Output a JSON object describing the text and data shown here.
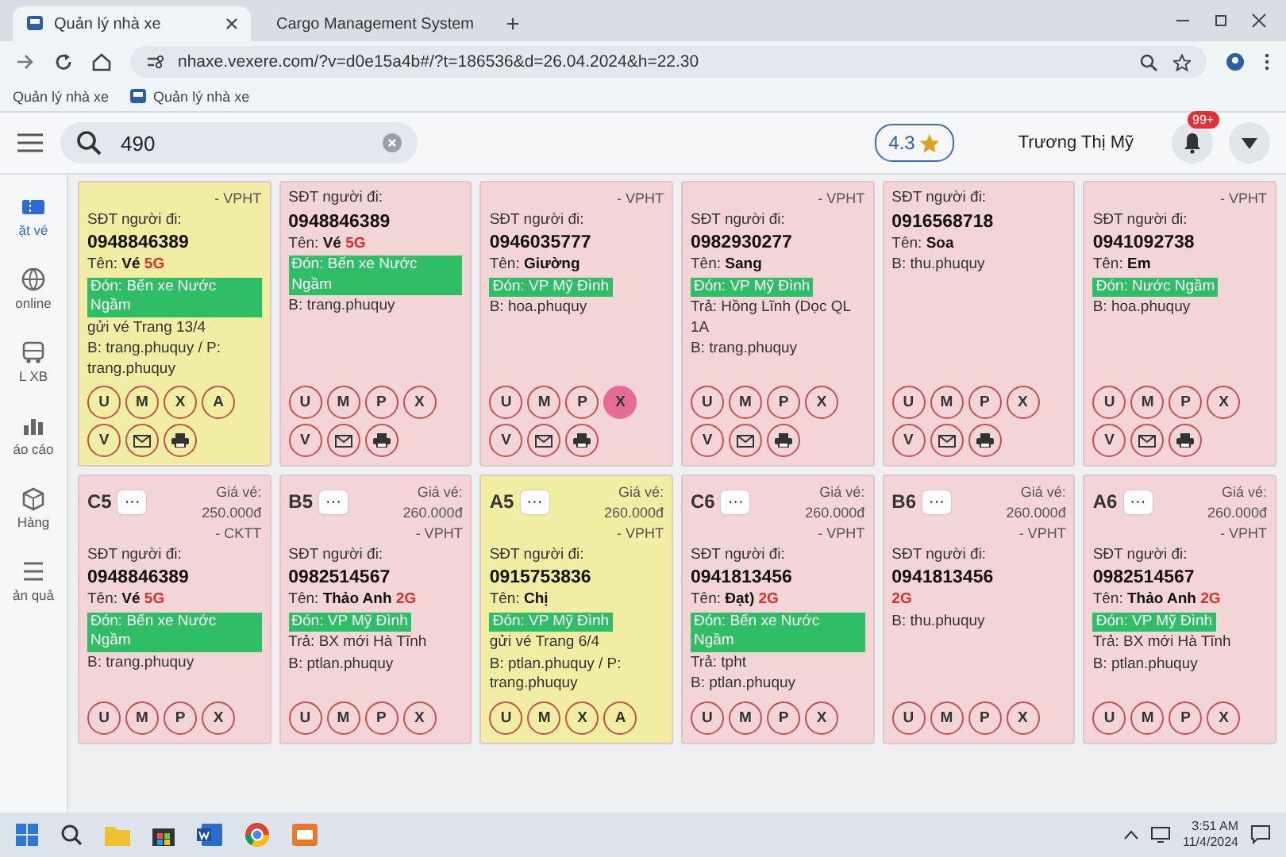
{
  "browser": {
    "tabs": [
      {
        "label": "Quản lý nhà xe",
        "selected": true
      },
      {
        "label": "Cargo Management System",
        "selected": false
      }
    ],
    "new_tab": "+",
    "url": "nhaxe.vexere.com/?v=d0e15a4b#/?t=186536&d=26.04.2024&h=22.30",
    "bookmarks": [
      "Quản lý nhà xe",
      "Quản lý nhà xe"
    ]
  },
  "header": {
    "search": {
      "value": "490"
    },
    "rating": "4.3",
    "user": "Trương Thị Mỹ",
    "notification_badge": "99+"
  },
  "sidebar": {
    "items": [
      {
        "label": "ặt vé",
        "selected": true
      },
      {
        "label": "online",
        "selected": false
      },
      {
        "label": "L XB",
        "selected": false
      },
      {
        "label": "áo cáo",
        "selected": false
      },
      {
        "label": "Hàng",
        "selected": false
      },
      {
        "label": "ản quả",
        "selected": false
      }
    ]
  },
  "cards": [
    {
      "color": "#f1eda3",
      "price_note": "- VPHT",
      "phone_label": "SĐT người đi:",
      "phone": "0948846389",
      "name_label": "Tên:",
      "name": "Vé",
      "tag": "5G",
      "pickup": "Đón: Bến xe Nước Ngầm",
      "note": "gửi vé Trang 13/4",
      "booked_by": "B: trang.phuquy / P: trang.phuquy",
      "actions": [
        {
          "kind": "letter",
          "label": "U",
          "selected": false
        },
        {
          "kind": "letter",
          "label": "M",
          "selected": false
        },
        {
          "kind": "letter",
          "label": "X",
          "selected": false
        },
        {
          "kind": "letter",
          "label": "A",
          "selected": false
        },
        {
          "kind": "letter",
          "label": "V",
          "selected": false
        },
        {
          "kind": "mail",
          "selected": false
        },
        {
          "kind": "print",
          "selected": false
        }
      ]
    },
    {
      "color": "#f3d5d8",
      "phone_label": "SĐT người đi:",
      "phone": "0948846389",
      "name_label": "Tên:",
      "name": "Vé",
      "tag": "5G",
      "pickup": "Đón: Bến xe Nước Ngầm",
      "booked_by": "B: trang.phuquy",
      "actions": [
        {
          "kind": "letter",
          "label": "U",
          "selected": false
        },
        {
          "kind": "letter",
          "label": "M",
          "selected": false
        },
        {
          "kind": "letter",
          "label": "P",
          "selected": false
        },
        {
          "kind": "letter",
          "label": "X",
          "selected": false
        },
        {
          "kind": "letter",
          "label": "V",
          "selected": false
        },
        {
          "kind": "mail",
          "selected": false
        },
        {
          "kind": "print",
          "selected": false
        }
      ]
    },
    {
      "color": "#f3d5d8",
      "price_note": "- VPHT",
      "phone_label": "SĐT người đi:",
      "phone": "0946035777",
      "name_label": "Tên:",
      "name": "Giường",
      "pickup": "Đón: VP Mỹ Đình",
      "booked_by": "B: hoa.phuquy",
      "actions": [
        {
          "kind": "letter",
          "label": "U",
          "selected": false
        },
        {
          "kind": "letter",
          "label": "M",
          "selected": false
        },
        {
          "kind": "letter",
          "label": "P",
          "selected": false
        },
        {
          "kind": "letter",
          "label": "X",
          "selected": true
        },
        {
          "kind": "letter",
          "label": "V",
          "selected": false
        },
        {
          "kind": "mail",
          "selected": false
        },
        {
          "kind": "print",
          "selected": false
        }
      ]
    },
    {
      "color": "#f3d5d8",
      "price_note": "- VPHT",
      "phone_label": "SĐT người đi:",
      "phone": "0982930277",
      "name_label": "Tên:",
      "name": "Sang",
      "pickup": "Đón: VP Mỹ Đình",
      "dropoff": "Trả: Hồng Lĩnh (Dọc QL 1A",
      "booked_by": "B: trang.phuquy",
      "actions": [
        {
          "kind": "letter",
          "label": "U",
          "selected": false
        },
        {
          "kind": "letter",
          "label": "M",
          "selected": false
        },
        {
          "kind": "letter",
          "label": "P",
          "selected": false
        },
        {
          "kind": "letter",
          "label": "X",
          "selected": false
        },
        {
          "kind": "letter",
          "label": "V",
          "selected": false
        },
        {
          "kind": "mail",
          "selected": false
        },
        {
          "kind": "print",
          "selected": false
        }
      ]
    },
    {
      "color": "#f3d5d8",
      "phone_label": "SĐT người đi:",
      "phone": "0916568718",
      "name_label": "Tên:",
      "name": "Soa",
      "booked_by": "B: thu.phuquy",
      "actions": [
        {
          "kind": "letter",
          "label": "U",
          "selected": false
        },
        {
          "kind": "letter",
          "label": "M",
          "selected": false
        },
        {
          "kind": "letter",
          "label": "P",
          "selected": false
        },
        {
          "kind": "letter",
          "label": "X",
          "selected": false
        },
        {
          "kind": "letter",
          "label": "V",
          "selected": false
        },
        {
          "kind": "mail",
          "selected": false
        },
        {
          "kind": "print",
          "selected": false
        }
      ]
    },
    {
      "color": "#f3d5d8",
      "price_note": "- VPHT",
      "phone_label": "SĐT người đi:",
      "phone": "0941092738",
      "name_label": "Tên:",
      "name": "Em",
      "pickup": "Đón: Nước Ngầm",
      "booked_by": "B: hoa.phuquy",
      "actions": [
        {
          "kind": "letter",
          "label": "U",
          "selected": false
        },
        {
          "kind": "letter",
          "label": "M",
          "selected": false
        },
        {
          "kind": "letter",
          "label": "P",
          "selected": false
        },
        {
          "kind": "letter",
          "label": "X",
          "selected": false
        },
        {
          "kind": "letter",
          "label": "V",
          "selected": false
        },
        {
          "kind": "mail",
          "selected": false
        },
        {
          "kind": "print",
          "selected": false
        }
      ]
    },
    {
      "color": "#f3d5d8",
      "seat": "C5",
      "more": "···",
      "price": "Giá vé: 250.000đ",
      "price_note": "- CKTT",
      "phone_label": "SĐT người đi:",
      "phone": "0948846389",
      "name_label": "Tên:",
      "name": "Vé",
      "tag": "5G",
      "pickup": "Đón: Bến xe Nước Ngầm",
      "booked_by": "B: trang.phuquy",
      "actions": [
        {
          "kind": "letter",
          "label": "U",
          "selected": false
        },
        {
          "kind": "letter",
          "label": "M",
          "selected": false
        },
        {
          "kind": "letter",
          "label": "P",
          "selected": false
        },
        {
          "kind": "letter",
          "label": "X",
          "selected": false
        }
      ]
    },
    {
      "color": "#f3d5d8",
      "seat": "B5",
      "more": "···",
      "price": "Giá vé: 260.000đ",
      "price_note": "- VPHT",
      "phone_label": "SĐT người đi:",
      "phone": "0982514567",
      "name_label": "Tên:",
      "name": "Thảo Anh",
      "tag": "2G",
      "pickup": "Đón: VP Mỹ Đình",
      "dropoff": "Trả: BX mới Hà Tĩnh",
      "booked_by": "B: ptlan.phuquy",
      "actions": [
        {
          "kind": "letter",
          "label": "U",
          "selected": false
        },
        {
          "kind": "letter",
          "label": "M",
          "selected": false
        },
        {
          "kind": "letter",
          "label": "P",
          "selected": false
        },
        {
          "kind": "letter",
          "label": "X",
          "selected": false
        }
      ]
    },
    {
      "color": "#f1eda3",
      "seat": "A5",
      "more": "···",
      "price": "Giá vé: 260.000đ",
      "price_note": "- VPHT",
      "phone_label": "SĐT người đi:",
      "phone": "0915753836",
      "name_label": "Tên:",
      "name": "Chị",
      "pickup": "Đón: VP Mỹ Đình",
      "note": "gửi vé Trang 6/4",
      "booked_by": "B: ptlan.phuquy / P: trang.phuquy",
      "actions": [
        {
          "kind": "letter",
          "label": "U",
          "selected": false
        },
        {
          "kind": "letter",
          "label": "M",
          "selected": false
        },
        {
          "kind": "letter",
          "label": "X",
          "selected": false
        },
        {
          "kind": "letter",
          "label": "A",
          "selected": false
        }
      ]
    },
    {
      "color": "#f3d5d8",
      "seat": "C6",
      "more": "···",
      "price": "Giá vé: 260.000đ",
      "price_note": "- VPHT",
      "phone_label": "SĐT người đi:",
      "phone": "0941813456",
      "name_label": "Tên:",
      "name": "Đạt)",
      "tag": "2G",
      "pickup": "Đón: Bến xe Nước Ngầm",
      "dropoff": "Trả: tpht",
      "booked_by": "B: ptlan.phuquy",
      "actions": [
        {
          "kind": "letter",
          "label": "U",
          "selected": false
        },
        {
          "kind": "letter",
          "label": "M",
          "selected": false
        },
        {
          "kind": "letter",
          "label": "P",
          "selected": false
        },
        {
          "kind": "letter",
          "label": "X",
          "selected": false
        }
      ]
    },
    {
      "color": "#f3d5d8",
      "seat": "B6",
      "more": "···",
      "price": "Giá vé: 260.000đ",
      "price_note": "- VPHT",
      "phone_label": "SĐT người đi:",
      "phone": "0941813456",
      "tag": "2G",
      "booked_by": "B: thu.phuquy",
      "actions": [
        {
          "kind": "letter",
          "label": "U",
          "selected": false
        },
        {
          "kind": "letter",
          "label": "M",
          "selected": false
        },
        {
          "kind": "letter",
          "label": "P",
          "selected": false
        },
        {
          "kind": "letter",
          "label": "X",
          "selected": false
        }
      ]
    },
    {
      "color": "#f3d5d8",
      "seat": "A6",
      "more": "···",
      "price": "Giá vé: 260.000đ",
      "price_note": "- VPHT",
      "phone_label": "SĐT người đi:",
      "phone": "0982514567",
      "name_label": "Tên:",
      "name": "Thảo Anh",
      "tag": "2G",
      "pickup": "Đón: VP Mỹ Đình",
      "dropoff": "Trả: BX mới Hà Tĩnh",
      "booked_by": "B: ptlan.phuquy",
      "actions": [
        {
          "kind": "letter",
          "label": "U",
          "selected": false
        },
        {
          "kind": "letter",
          "label": "M",
          "selected": false
        },
        {
          "kind": "letter",
          "label": "P",
          "selected": false
        },
        {
          "kind": "letter",
          "label": "X",
          "selected": false
        }
      ]
    }
  ],
  "taskbar": {
    "time": "3:51 AM",
    "date": "11/4/2024"
  }
}
